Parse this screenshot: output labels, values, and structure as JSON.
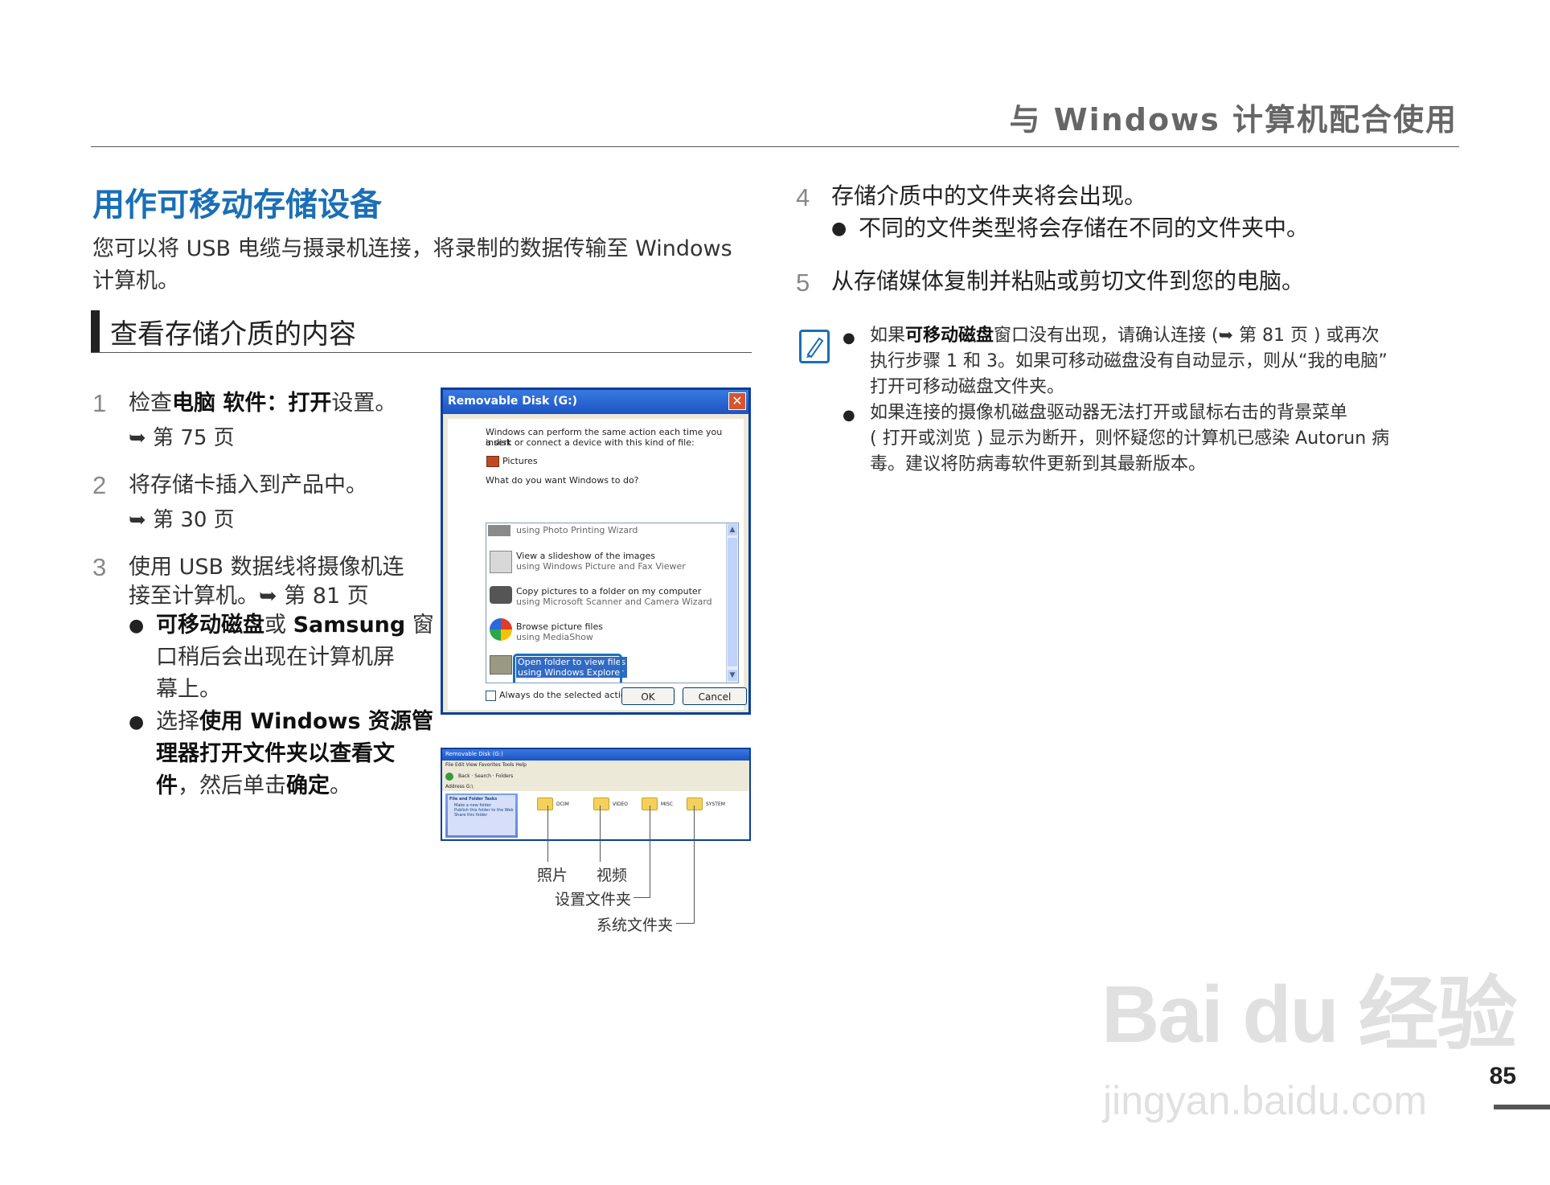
{
  "header": {
    "running_title": "与 Windows 计算机配合使用"
  },
  "section": {
    "title": "用作可移动存储设备",
    "intro_line1": "您可以将 USB 电缆与摄录机连接，将录制的数据传输至 Windows",
    "intro_line2": "计算机。",
    "subhead": "查看存储介质的内容"
  },
  "steps_left": [
    {
      "num": "1",
      "pre": "检查",
      "bold": "电脑  软件：打开",
      "post": "设置。",
      "ref": "➥ 第 75 页"
    },
    {
      "num": "2",
      "text": "将存储卡插入到产品中。",
      "ref": "➥ 第 30 页"
    },
    {
      "num": "3",
      "line1": "使用 USB 数据线将摄像机连",
      "line2": "接至计算机。➥ 第 81 页"
    }
  ],
  "bullets_left": [
    {
      "bold1": "可移动磁盘",
      "mid1": "或 ",
      "bold2": "Samsung",
      "post1": " 窗",
      "line2": "口稍后会出现在计算机屏",
      "line3": "幕上。"
    },
    {
      "pre": "选择",
      "bold_a": "使用 Windows 资源管",
      "bold_b": "理器打开文件夹以查看文",
      "bold_c": "件",
      "mid": "，然后单击",
      "bold_d": "确定",
      "post": "。"
    }
  ],
  "dialog": {
    "title": "Removable Disk (G:)",
    "close_glyph": "✕",
    "prompt_line1": "Windows can perform the same action each time you insert",
    "prompt_line2": "a disk or connect a device with this kind of file:",
    "content_type": "Pictures",
    "question": "What do you want Windows to do?",
    "items": [
      {
        "main": "",
        "sub": "using Photo Printing Wizard"
      },
      {
        "main": "View a slideshow of the images",
        "sub": "using Windows Picture and Fax Viewer"
      },
      {
        "main": "Copy pictures to a folder on my computer",
        "sub": "using Microsoft Scanner and Camera Wizard"
      },
      {
        "main": "Browse picture files",
        "sub": "using MediaShow"
      },
      {
        "main": "Open folder to view files",
        "sub": "using Windows Explorer"
      }
    ],
    "always": "Always do the selected action.",
    "ok": "OK",
    "cancel": "Cancel"
  },
  "explorer": {
    "title": "Removable Disk (G:)",
    "menu": "File  Edit  View  Favorites  Tools  Help",
    "toolbar": "Back · Search · Folders",
    "address": "Address  G:\\",
    "panel_title": "File and Folder Tasks",
    "panel_items": [
      "Make a new folder",
      "Publish this folder to the Web",
      "Share this folder"
    ],
    "folders": [
      "DCIM",
      "VIDEO",
      "MISC",
      "SYSTEM"
    ]
  },
  "callouts": {
    "photo": "照片",
    "video": "视频",
    "settings": "设置文件夹",
    "system": "系统文件夹"
  },
  "steps_right": [
    {
      "num": "4",
      "text": "存储介质中的文件夹将会出现。",
      "bullet": "不同的文件类型将会存储在不同的文件夹中。"
    },
    {
      "num": "5",
      "text": "从存储媒体复制并粘贴或剪切文件到您的电脑。"
    }
  ],
  "notes": {
    "n1_pre": "如果",
    "n1_bold": "可移动磁盘",
    "n1_post": "窗口没有出现，请确认连接 (➥ 第 81 页 ) 或再次",
    "n1_line2": "执行步骤 1 和 3。如果可移动磁盘没有自动显示，则从“我的电脑”",
    "n1_line3": "打开可移动磁盘文件夹。",
    "n2_line1": "如果连接的摄像机磁盘驱动器无法打开或鼠标右击的背景菜单",
    "n2_line2": "( 打开或浏览 ) 显示为断开，则怀疑您的计算机已感染 Autorun 病",
    "n2_line3": "毒。建议将防病毒软件更新到其最新版本。"
  },
  "page_number": "85",
  "watermark": {
    "logo": "Bai du 经验",
    "url": "jingyan.baidu.com"
  }
}
